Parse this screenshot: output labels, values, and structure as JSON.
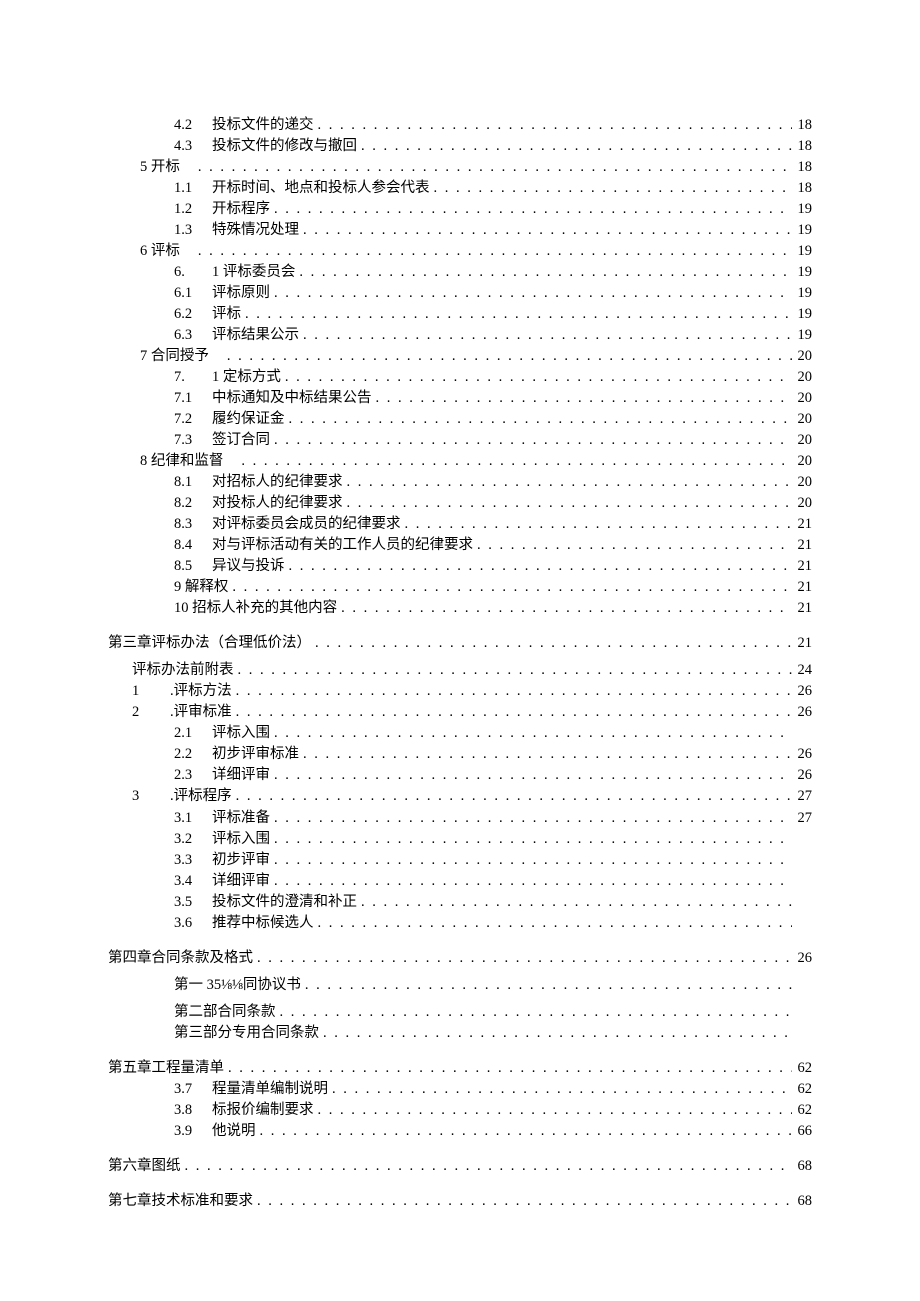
{
  "toc": [
    {
      "cls": "indent-a",
      "num": "4.2",
      "label": "投标文件的递交",
      "page": "18"
    },
    {
      "cls": "indent-a",
      "num": "4.3",
      "label": "投标文件的修改与撤回",
      "page": "18"
    },
    {
      "cls": "indent-b",
      "num": "5 开标",
      "label": "",
      "page": "18"
    },
    {
      "cls": "indent-a",
      "num": "1.1",
      "label": "开标时间、地点和投标人参会代表",
      "page": "18"
    },
    {
      "cls": "indent-a",
      "num": "1.2",
      "label": "开标程序",
      "page": "19"
    },
    {
      "cls": "indent-a",
      "num": "1.3",
      "label": "特殊情况处理",
      "page": "19"
    },
    {
      "cls": "indent-b",
      "num": "6 评标",
      "label": "",
      "page": "19"
    },
    {
      "cls": "indent-a",
      "num": "6.",
      "label": "1 评标委员会",
      "page": "19"
    },
    {
      "cls": "indent-a",
      "num": "6.1",
      "label": "评标原则",
      "page": "19"
    },
    {
      "cls": "indent-a",
      "num": "6.2",
      "label": "评标",
      "page": "19"
    },
    {
      "cls": "indent-a",
      "num": "6.3",
      "label": "评标结果公示",
      "page": "19"
    },
    {
      "cls": "indent-b",
      "num": "7 合同授予",
      "label": "",
      "page": "20"
    },
    {
      "cls": "indent-a",
      "num": "7.",
      "label": "1 定标方式",
      "page": "20"
    },
    {
      "cls": "indent-a",
      "num": "7.1",
      "label": "中标通知及中标结果公告",
      "page": "20"
    },
    {
      "cls": "indent-a",
      "num": "7.2",
      "label": "履约保证金",
      "page": "20"
    },
    {
      "cls": "indent-a",
      "num": "7.3",
      "label": "签订合同",
      "page": "20"
    },
    {
      "cls": "indent-b",
      "num": "8 纪律和监督",
      "label": "",
      "page": "20"
    },
    {
      "cls": "indent-a",
      "num": "8.1",
      "label": "对招标人的纪律要求",
      "page": "20"
    },
    {
      "cls": "indent-a",
      "num": "8.2",
      "label": "对投标人的纪律要求",
      "page": "20"
    },
    {
      "cls": "indent-a",
      "num": "8.3",
      "label": "对评标委员会成员的纪律要求",
      "page": "21"
    },
    {
      "cls": "indent-a",
      "num": "8.4",
      "label": "对与评标活动有关的工作人员的纪律要求",
      "page": "21"
    },
    {
      "cls": "indent-a",
      "num": "8.5",
      "label": "异议与投诉",
      "page": "21"
    },
    {
      "cls": "indent-a",
      "num": "",
      "label": "9 解释权",
      "page": "21"
    },
    {
      "cls": "indent-a",
      "num": "",
      "label": "10 招标人补充的其他内容",
      "page": "21"
    },
    {
      "cls": "indent-c section-gap",
      "num": "",
      "label": "第三章评标办法（合理低价法）",
      "page": "21"
    },
    {
      "cls": "indent-d section-gap-sm",
      "num": "",
      "label": "评标办法前附表",
      "page": "24"
    },
    {
      "cls": "indent-d",
      "num": "1",
      "label": ".评标方法",
      "page": "26"
    },
    {
      "cls": "indent-d",
      "num": "2",
      "label": ".评审标准",
      "page": "26"
    },
    {
      "cls": "indent-a",
      "num": "2.1",
      "label": "评标入围",
      "page": ""
    },
    {
      "cls": "indent-a",
      "num": "2.2",
      "label": "初步评审标准",
      "page": "26"
    },
    {
      "cls": "indent-a",
      "num": "2.3",
      "label": "详细评审",
      "page": "26"
    },
    {
      "cls": "indent-d",
      "num": "3",
      "label": ".评标程序",
      "page": "27"
    },
    {
      "cls": "indent-a",
      "num": "3.1",
      "label": "评标准备",
      "page": "27"
    },
    {
      "cls": "indent-a",
      "num": "3.2",
      "label": "评标入围",
      "page": ""
    },
    {
      "cls": "indent-a",
      "num": "3.3",
      "label": "初步评审",
      "page": ""
    },
    {
      "cls": "indent-a",
      "num": "3.4",
      "label": "详细评审",
      "page": ""
    },
    {
      "cls": "indent-a",
      "num": "3.5",
      "label": "投标文件的澄清和补正",
      "page": ""
    },
    {
      "cls": "indent-a",
      "num": "3.6",
      "label": "推荐中标候选人",
      "page": ""
    },
    {
      "cls": "indent-c section-gap",
      "num": "",
      "label": "第四章合同条款及格式",
      "page": "26"
    },
    {
      "cls": "indent-a section-gap-sm",
      "num": "",
      "label": "第一 35⅛⅛同协议书",
      "page": ""
    },
    {
      "cls": "indent-a section-gap-sm",
      "num": "",
      "label": "第二部合同条款",
      "page": ""
    },
    {
      "cls": "indent-a",
      "num": "",
      "label": "第三部分专用合同条款",
      "page": ""
    },
    {
      "cls": "indent-c section-gap",
      "num": "",
      "label": "第五章工程量清单",
      "page": "62"
    },
    {
      "cls": "indent-a",
      "num": "3.7",
      "label": "程量清单编制说明",
      "page": "62"
    },
    {
      "cls": "indent-a",
      "num": "3.8",
      "label": "标报价编制要求",
      "page": "62"
    },
    {
      "cls": "indent-a",
      "num": "3.9",
      "label": "他说明",
      "page": "66"
    },
    {
      "cls": "indent-c section-gap",
      "num": "",
      "label": "第六章图纸",
      "page": "68"
    },
    {
      "cls": "indent-c section-gap",
      "num": "",
      "label": "第七章技术标准和要求",
      "page": "68"
    }
  ]
}
